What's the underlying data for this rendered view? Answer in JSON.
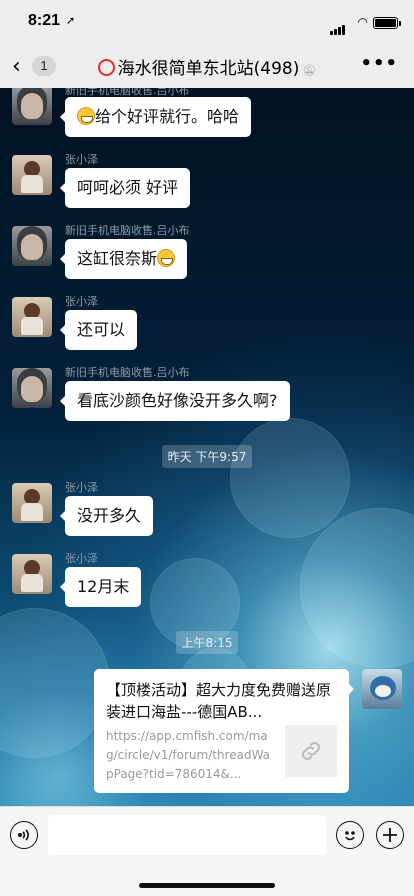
{
  "status": {
    "time": "8:21",
    "location_icon": "location-arrow-icon"
  },
  "nav": {
    "back_count": "1",
    "title": "海水很简单东北站(498)",
    "more_label": "•••"
  },
  "messages": [
    {
      "sender": "新旧手机电脑收售.吕小布",
      "text": "给个好评就行。哈哈",
      "emoji_before": true,
      "emoji_after": false
    },
    {
      "sender": "张小泽",
      "text": "呵呵必须 好评"
    },
    {
      "sender": "新旧手机电脑收售.吕小布",
      "text": "这缸很奈斯",
      "emoji_after": true
    },
    {
      "sender": "张小泽",
      "text": "还可以"
    },
    {
      "sender": "新旧手机电脑收售.吕小布",
      "text": "看底沙颜色好像没开多久啊?"
    },
    {
      "sender": "张小泽",
      "text": "没开多久"
    },
    {
      "sender": "张小泽",
      "text": "12月末"
    }
  ],
  "timestamps": [
    "昨天 下午9:57",
    "上午8:15"
  ],
  "link_card": {
    "title": "【顶楼活动】超大力度免费赠送原装进口海盐---德国AB...",
    "url": "https://app.cmfish.com/mag/circle/v1/forum/threadWapPage?tid=786014&..."
  },
  "input": {
    "placeholder": ""
  }
}
